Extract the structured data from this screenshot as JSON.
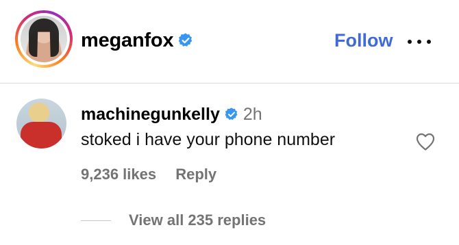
{
  "post": {
    "username": "meganfox",
    "follow_label": "Follow",
    "verified_color": "#3797f0"
  },
  "comment": {
    "username": "machinegunkelly",
    "time": "2h",
    "text": "stoked i have your phone number",
    "likes": "9,236 likes",
    "reply_label": "Reply",
    "view_replies": "View all 235 replies"
  },
  "icons": {
    "verified": "verified-badge-icon",
    "more": "more-horizontal-icon",
    "like": "heart-outline-icon"
  }
}
